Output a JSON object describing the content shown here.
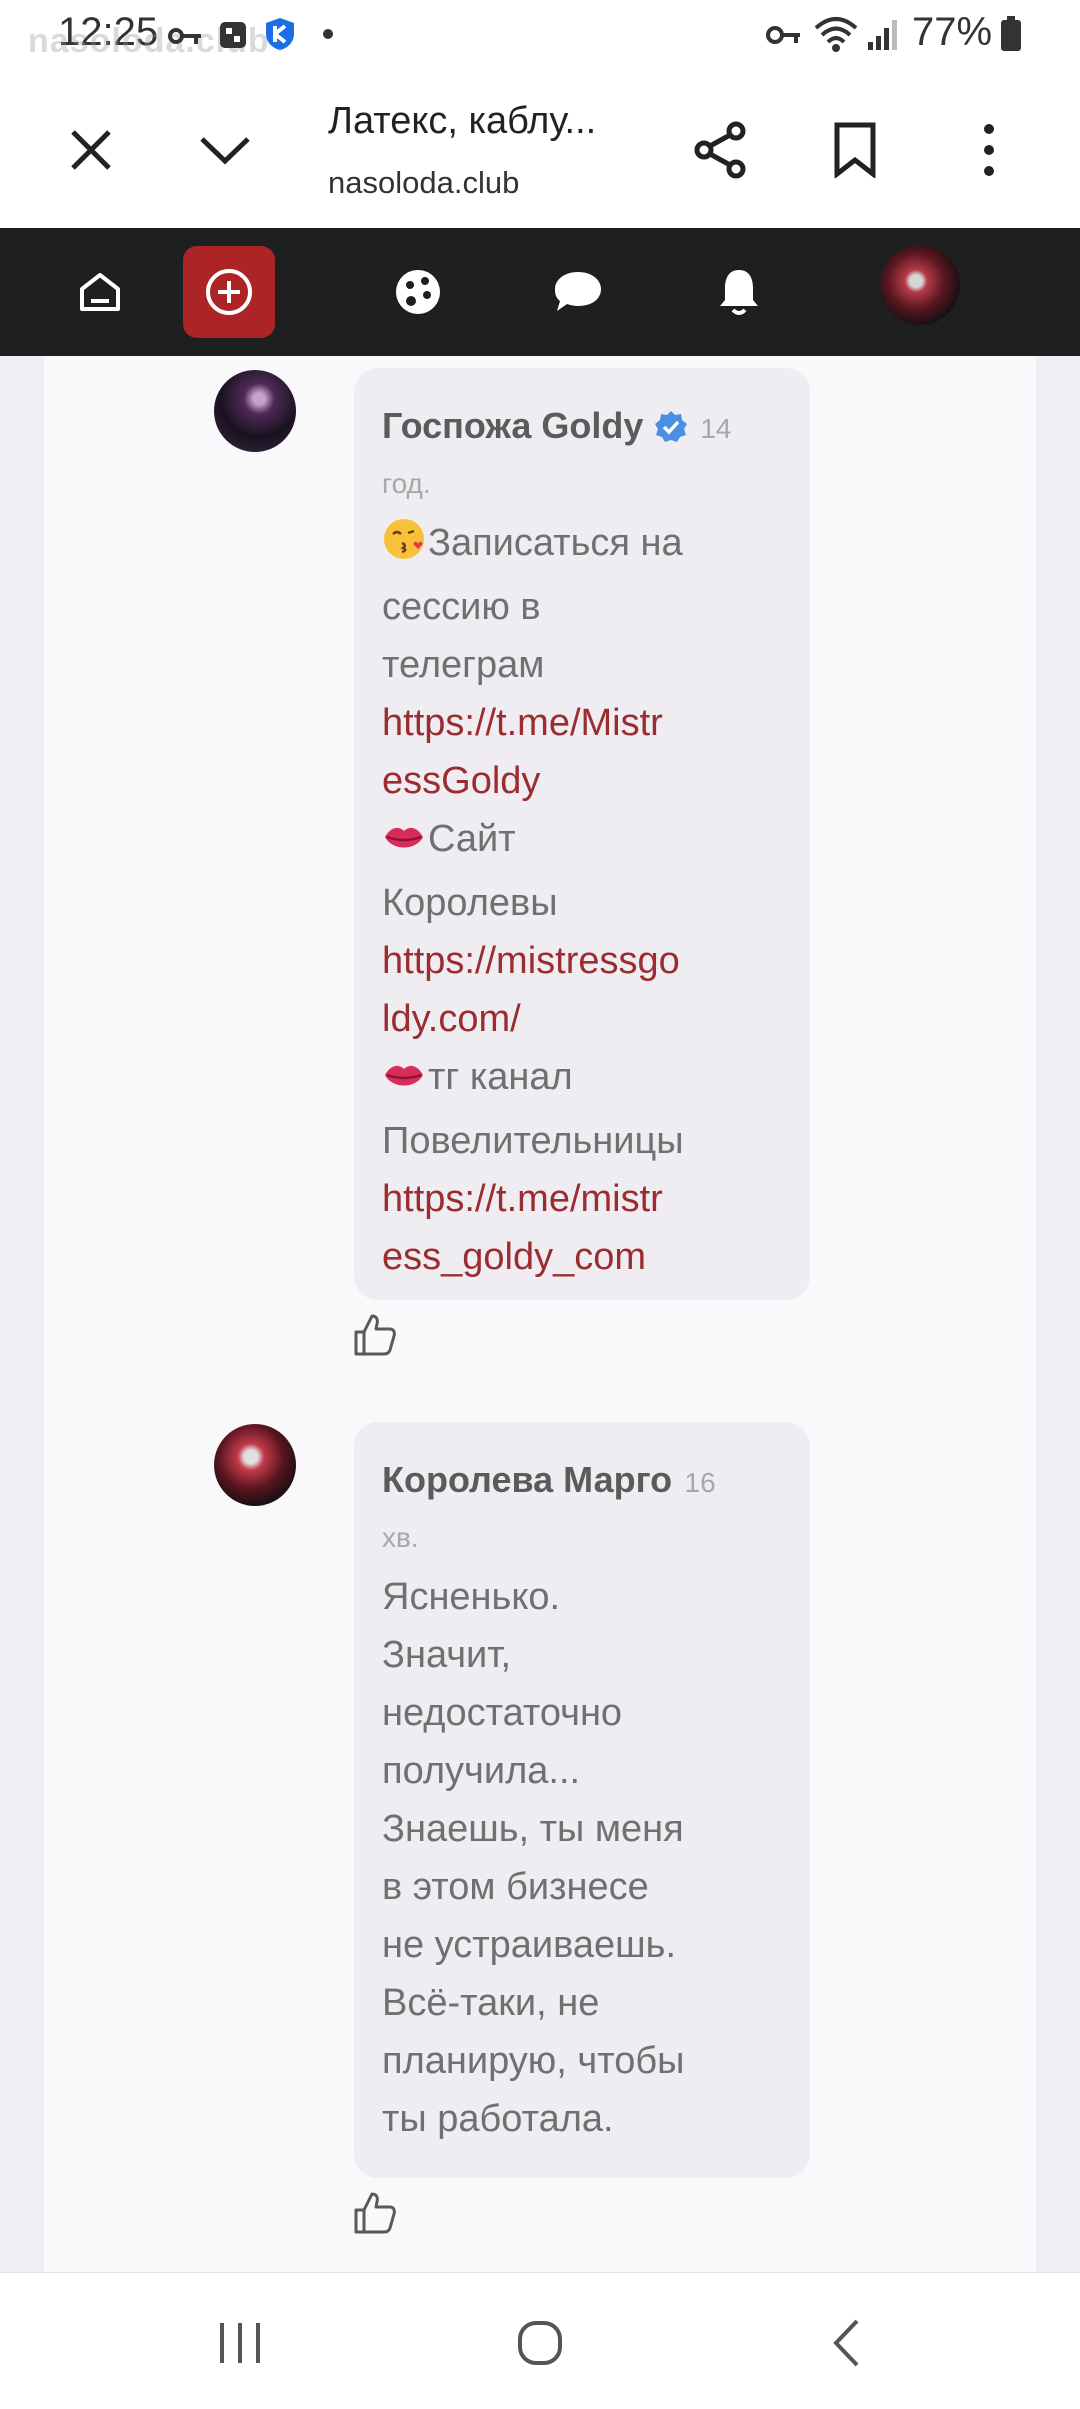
{
  "status_bar": {
    "time": "12:25",
    "watermark": "nasoloda.club",
    "battery": "77%"
  },
  "browser": {
    "page_title": "Латекс, каблу...",
    "domain": "nasoloda.club"
  },
  "colors": {
    "accent": "#ad2427",
    "nav_bg": "#1e201f",
    "link": "#9b2c2f",
    "verified": "#4a90e2"
  },
  "comments": [
    {
      "author": "Госпожа Goldy",
      "verified": true,
      "time_value": "14",
      "time_unit": "год.",
      "lines": [
        {
          "emoji": "😘",
          "text": "Записаться на"
        },
        {
          "text": "сессию в"
        },
        {
          "text": "телеграм"
        },
        {
          "text": "https://t.me/Mistr",
          "link": true
        },
        {
          "text": "essGoldy",
          "link": true
        },
        {
          "emoji": "💋",
          "text": "Сайт"
        },
        {
          "text": "Королевы"
        },
        {
          "text": "https://mistressgo",
          "link": true
        },
        {
          "text": "ldy.com/",
          "link": true
        },
        {
          "emoji": "💋",
          "text": "тг канал"
        },
        {
          "text": "Повелительницы"
        },
        {
          "text": "https://t.me/mistr",
          "link": true
        },
        {
          "text": "ess_goldy_com",
          "link": true
        }
      ]
    },
    {
      "author": "Королева Марго",
      "verified": false,
      "time_value": "16",
      "time_unit": "хв.",
      "lines": [
        {
          "text": "Ясненько."
        },
        {
          "text": "Значит,"
        },
        {
          "text": "недостаточно"
        },
        {
          "text": "получила..."
        },
        {
          "text": "Знаешь, ты меня"
        },
        {
          "text": "в этом бизнесе"
        },
        {
          "text": "не устраиваешь."
        },
        {
          "text": "Всё-таки, не"
        },
        {
          "text": "планирую, чтобы"
        },
        {
          "text": "ты работала."
        }
      ]
    }
  ]
}
